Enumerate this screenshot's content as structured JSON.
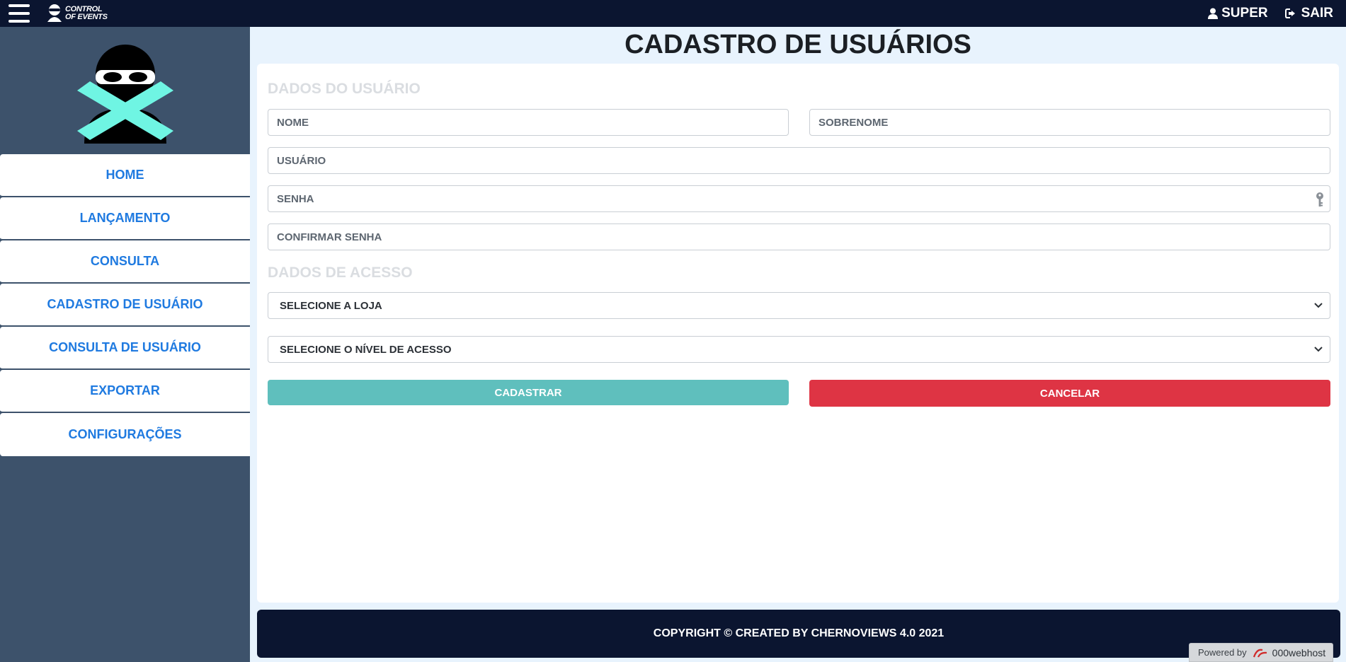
{
  "topbar": {
    "brand_line1": "CONTROL",
    "brand_line2": "OF EVENTS",
    "user_label": "SUPER",
    "logout_label": "SAIR"
  },
  "sidebar": {
    "items": [
      {
        "label": "HOME"
      },
      {
        "label": "LANÇAMENTO"
      },
      {
        "label": "CONSULTA"
      },
      {
        "label": "CADASTRO DE USUÁRIO"
      },
      {
        "label": "CONSULTA DE USUÁRIO"
      },
      {
        "label": "EXPORTAR"
      },
      {
        "label": "CONFIGURAÇÕES"
      }
    ]
  },
  "page": {
    "title": "CADASTRO DE USUÁRIOS"
  },
  "form": {
    "section_user": "DADOS DO USUÁRIO",
    "nome_placeholder": "NOME",
    "sobrenome_placeholder": "SOBRENOME",
    "usuario_placeholder": "USUÁRIO",
    "senha_placeholder": "SENHA",
    "confirmar_placeholder": "CONFIRMAR SENHA",
    "section_access": "DADOS DE ACESSO",
    "select_loja": "SELECIONE A LOJA",
    "select_nivel": "SELECIONE O NÍVEL DE ACESSO",
    "submit_label": "CADASTRAR",
    "cancel_label": "CANCELAR"
  },
  "footer": {
    "copyright": "COPYRIGHT © CREATED BY CHERNOVIEWS 4.0 2021"
  },
  "powered": {
    "prefix": "Powered by",
    "host": "000webhost"
  },
  "colors": {
    "topbar": "#0b1530",
    "sidebar": "#3d526b",
    "accent_link": "#1f7ae0",
    "logo_x": "#6ff5e3",
    "primary_button": "#5fbfbd",
    "danger_button": "#de3444",
    "main_bg": "#e8f3fd"
  },
  "icons": {
    "menu": "hamburger-icon",
    "user": "user-icon",
    "logout": "logout-icon",
    "password": "key-icon",
    "select": "chevron-down-icon"
  }
}
